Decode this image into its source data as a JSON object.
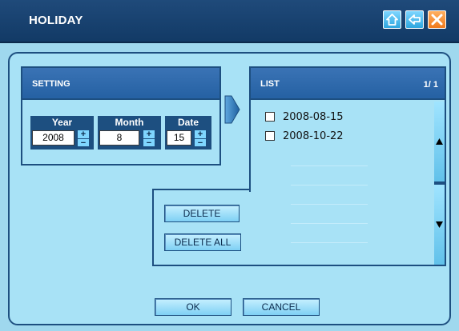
{
  "window": {
    "title": "HOLIDAY"
  },
  "titlebar_icons": [
    "home-icon",
    "back-arrow-icon",
    "close-icon"
  ],
  "colors": {
    "titlebar": "#1f4a7a",
    "background": "#9fd8ee",
    "accent_close": "#f07a1c"
  },
  "setting": {
    "header": "SETTING",
    "fields": [
      {
        "label": "Year",
        "value": "2008"
      },
      {
        "label": "Month",
        "value": "8"
      },
      {
        "label": "Date",
        "value": "15"
      }
    ],
    "stepper_plus": "+",
    "stepper_minus": "−"
  },
  "list": {
    "header": "LIST",
    "page_indicator": "1/  1",
    "items": [
      {
        "date": "2008-08-15",
        "checked": false
      },
      {
        "date": "2008-10-22",
        "checked": false
      }
    ]
  },
  "actions": {
    "delete": "DELETE",
    "delete_all": "DELETE ALL"
  },
  "footer": {
    "ok": "OK",
    "cancel": "CANCEL"
  }
}
